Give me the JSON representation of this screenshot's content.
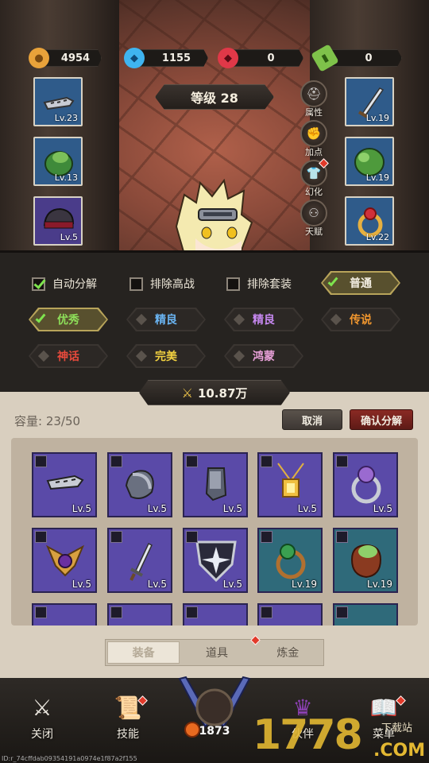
{
  "resources": [
    {
      "name": "gold",
      "value": "4954",
      "color": "#e8a23a",
      "icon": "coin-icon"
    },
    {
      "name": "diamond",
      "value": "1155",
      "color": "#3fb4f0",
      "icon": "blue-gem-icon"
    },
    {
      "name": "ruby",
      "value": "0",
      "color": "#e03848",
      "icon": "red-gem-icon"
    },
    {
      "name": "stamina",
      "value": "0",
      "color": "#7ec24a",
      "icon": "green-battery-icon"
    }
  ],
  "level_label": "等级 28",
  "left_slots": [
    {
      "lv": "Lv.23"
    },
    {
      "lv": "Lv.13"
    },
    {
      "lv": "Lv.5"
    }
  ],
  "right_slots": [
    {
      "lv": "Lv.19"
    },
    {
      "lv": "Lv.19"
    },
    {
      "lv": "Lv.22"
    }
  ],
  "side_buttons": [
    {
      "label": "属性"
    },
    {
      "label": "加点"
    },
    {
      "label": "幻化"
    },
    {
      "label": "天赋"
    }
  ],
  "filters": {
    "checkboxes": [
      {
        "label": "自动分解",
        "checked": true
      },
      {
        "label": "排除高战",
        "checked": false
      },
      {
        "label": "排除套装",
        "checked": false
      }
    ],
    "qualities": [
      {
        "label": "普通",
        "selected": true,
        "color": "#f4efe4"
      },
      {
        "label": "优秀",
        "selected": true,
        "color": "#8ee05a"
      },
      {
        "label": "精良",
        "selected": false,
        "color": "#6ab4f2"
      },
      {
        "label": "精良",
        "selected": false,
        "color": "#c688f0"
      },
      {
        "label": "传说",
        "selected": false,
        "color": "#f0962e"
      },
      {
        "label": "神话",
        "selected": false,
        "color": "#e84a3c"
      },
      {
        "label": "完美",
        "selected": false,
        "color": "#f0d040"
      },
      {
        "label": "鸿蒙",
        "selected": false,
        "color": "#e8a0d8"
      }
    ]
  },
  "power": "10.87万",
  "bag": {
    "capacity": "容量: 23/50",
    "cancel": "取消",
    "confirm": "确认分解",
    "items": [
      {
        "lv": "Lv.5",
        "icon": "visor-icon"
      },
      {
        "lv": "Lv.5",
        "icon": "gauntlet-icon"
      },
      {
        "lv": "Lv.5",
        "icon": "boot-icon"
      },
      {
        "lv": "Lv.5",
        "icon": "pendant-icon"
      },
      {
        "lv": "Lv.5",
        "icon": "ring-icon"
      },
      {
        "lv": "Lv.5",
        "icon": "amulet-icon"
      },
      {
        "lv": "Lv.5",
        "icon": "dagger-icon"
      },
      {
        "lv": "Lv.5",
        "icon": "shield-icon"
      },
      {
        "lv": "Lv.19",
        "icon": "emerald-ring-icon"
      },
      {
        "lv": "Lv.19",
        "icon": "sack-icon"
      }
    ],
    "tabs": [
      {
        "label": "装备",
        "active": true
      },
      {
        "label": "道具",
        "active": false
      },
      {
        "label": "炼金",
        "active": false
      }
    ]
  },
  "nav": {
    "close": "关闭",
    "skill": "技能",
    "battle_value": "1873",
    "partner": "伙伴",
    "menu": "菜单"
  },
  "watermark": {
    "main": "1778",
    "sub": "下载站",
    "com": ".COM"
  },
  "uid": "ID:r_74cffdab09354191a0974e1f87a2f155"
}
